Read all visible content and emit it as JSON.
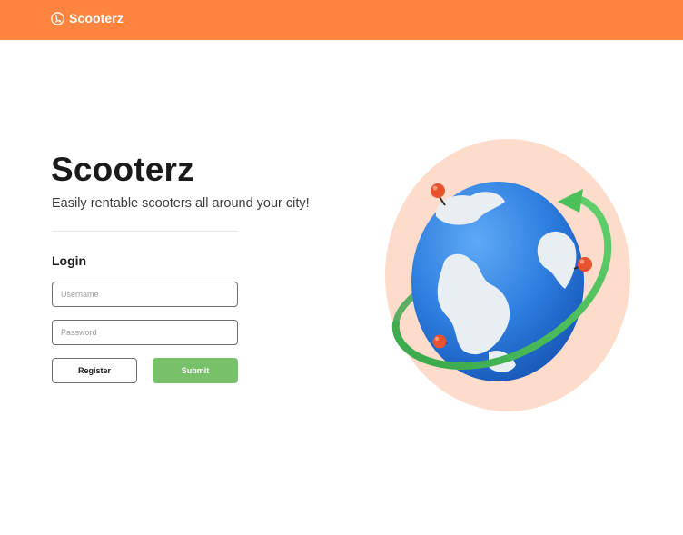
{
  "header": {
    "brand_name": "Scooterz",
    "background_color": "#ff8440",
    "logo_icon": "scooter-logo-icon"
  },
  "hero": {
    "title": "Scooterz",
    "tagline": "Easily rentable scooters all around your city!"
  },
  "login": {
    "heading": "Login",
    "username": {
      "placeholder": "Username",
      "value": ""
    },
    "password": {
      "placeholder": "Password",
      "value": ""
    },
    "register_label": "Register",
    "submit_label": "Submit",
    "submit_color": "#78c06a"
  },
  "illustration": {
    "icon": "globe-with-pins-illustration",
    "backdrop_color": "#fddccb",
    "globe_color": "#2f7fe0",
    "orbit_arrow_color": "#4bbf5a",
    "pin_color": "#e8532f"
  }
}
